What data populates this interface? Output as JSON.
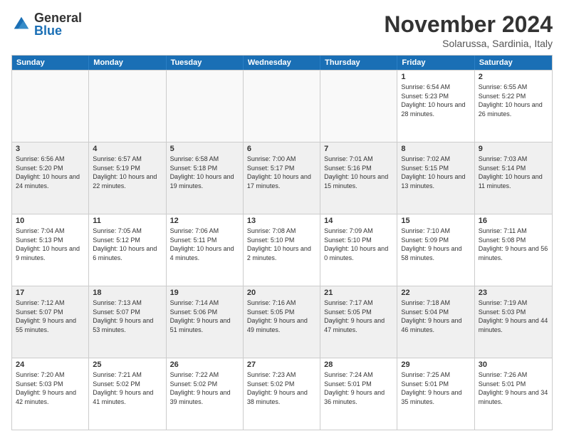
{
  "logo": {
    "general": "General",
    "blue": "Blue"
  },
  "title": "November 2024",
  "subtitle": "Solarussa, Sardinia, Italy",
  "days": [
    "Sunday",
    "Monday",
    "Tuesday",
    "Wednesday",
    "Thursday",
    "Friday",
    "Saturday"
  ],
  "weeks": [
    [
      {
        "day": "",
        "info": ""
      },
      {
        "day": "",
        "info": ""
      },
      {
        "day": "",
        "info": ""
      },
      {
        "day": "",
        "info": ""
      },
      {
        "day": "",
        "info": ""
      },
      {
        "day": "1",
        "info": "Sunrise: 6:54 AM\nSunset: 5:23 PM\nDaylight: 10 hours and 28 minutes."
      },
      {
        "day": "2",
        "info": "Sunrise: 6:55 AM\nSunset: 5:22 PM\nDaylight: 10 hours and 26 minutes."
      }
    ],
    [
      {
        "day": "3",
        "info": "Sunrise: 6:56 AM\nSunset: 5:20 PM\nDaylight: 10 hours and 24 minutes."
      },
      {
        "day": "4",
        "info": "Sunrise: 6:57 AM\nSunset: 5:19 PM\nDaylight: 10 hours and 22 minutes."
      },
      {
        "day": "5",
        "info": "Sunrise: 6:58 AM\nSunset: 5:18 PM\nDaylight: 10 hours and 19 minutes."
      },
      {
        "day": "6",
        "info": "Sunrise: 7:00 AM\nSunset: 5:17 PM\nDaylight: 10 hours and 17 minutes."
      },
      {
        "day": "7",
        "info": "Sunrise: 7:01 AM\nSunset: 5:16 PM\nDaylight: 10 hours and 15 minutes."
      },
      {
        "day": "8",
        "info": "Sunrise: 7:02 AM\nSunset: 5:15 PM\nDaylight: 10 hours and 13 minutes."
      },
      {
        "day": "9",
        "info": "Sunrise: 7:03 AM\nSunset: 5:14 PM\nDaylight: 10 hours and 11 minutes."
      }
    ],
    [
      {
        "day": "10",
        "info": "Sunrise: 7:04 AM\nSunset: 5:13 PM\nDaylight: 10 hours and 9 minutes."
      },
      {
        "day": "11",
        "info": "Sunrise: 7:05 AM\nSunset: 5:12 PM\nDaylight: 10 hours and 6 minutes."
      },
      {
        "day": "12",
        "info": "Sunrise: 7:06 AM\nSunset: 5:11 PM\nDaylight: 10 hours and 4 minutes."
      },
      {
        "day": "13",
        "info": "Sunrise: 7:08 AM\nSunset: 5:10 PM\nDaylight: 10 hours and 2 minutes."
      },
      {
        "day": "14",
        "info": "Sunrise: 7:09 AM\nSunset: 5:10 PM\nDaylight: 10 hours and 0 minutes."
      },
      {
        "day": "15",
        "info": "Sunrise: 7:10 AM\nSunset: 5:09 PM\nDaylight: 9 hours and 58 minutes."
      },
      {
        "day": "16",
        "info": "Sunrise: 7:11 AM\nSunset: 5:08 PM\nDaylight: 9 hours and 56 minutes."
      }
    ],
    [
      {
        "day": "17",
        "info": "Sunrise: 7:12 AM\nSunset: 5:07 PM\nDaylight: 9 hours and 55 minutes."
      },
      {
        "day": "18",
        "info": "Sunrise: 7:13 AM\nSunset: 5:07 PM\nDaylight: 9 hours and 53 minutes."
      },
      {
        "day": "19",
        "info": "Sunrise: 7:14 AM\nSunset: 5:06 PM\nDaylight: 9 hours and 51 minutes."
      },
      {
        "day": "20",
        "info": "Sunrise: 7:16 AM\nSunset: 5:05 PM\nDaylight: 9 hours and 49 minutes."
      },
      {
        "day": "21",
        "info": "Sunrise: 7:17 AM\nSunset: 5:05 PM\nDaylight: 9 hours and 47 minutes."
      },
      {
        "day": "22",
        "info": "Sunrise: 7:18 AM\nSunset: 5:04 PM\nDaylight: 9 hours and 46 minutes."
      },
      {
        "day": "23",
        "info": "Sunrise: 7:19 AM\nSunset: 5:03 PM\nDaylight: 9 hours and 44 minutes."
      }
    ],
    [
      {
        "day": "24",
        "info": "Sunrise: 7:20 AM\nSunset: 5:03 PM\nDaylight: 9 hours and 42 minutes."
      },
      {
        "day": "25",
        "info": "Sunrise: 7:21 AM\nSunset: 5:02 PM\nDaylight: 9 hours and 41 minutes."
      },
      {
        "day": "26",
        "info": "Sunrise: 7:22 AM\nSunset: 5:02 PM\nDaylight: 9 hours and 39 minutes."
      },
      {
        "day": "27",
        "info": "Sunrise: 7:23 AM\nSunset: 5:02 PM\nDaylight: 9 hours and 38 minutes."
      },
      {
        "day": "28",
        "info": "Sunrise: 7:24 AM\nSunset: 5:01 PM\nDaylight: 9 hours and 36 minutes."
      },
      {
        "day": "29",
        "info": "Sunrise: 7:25 AM\nSunset: 5:01 PM\nDaylight: 9 hours and 35 minutes."
      },
      {
        "day": "30",
        "info": "Sunrise: 7:26 AM\nSunset: 5:01 PM\nDaylight: 9 hours and 34 minutes."
      }
    ]
  ]
}
